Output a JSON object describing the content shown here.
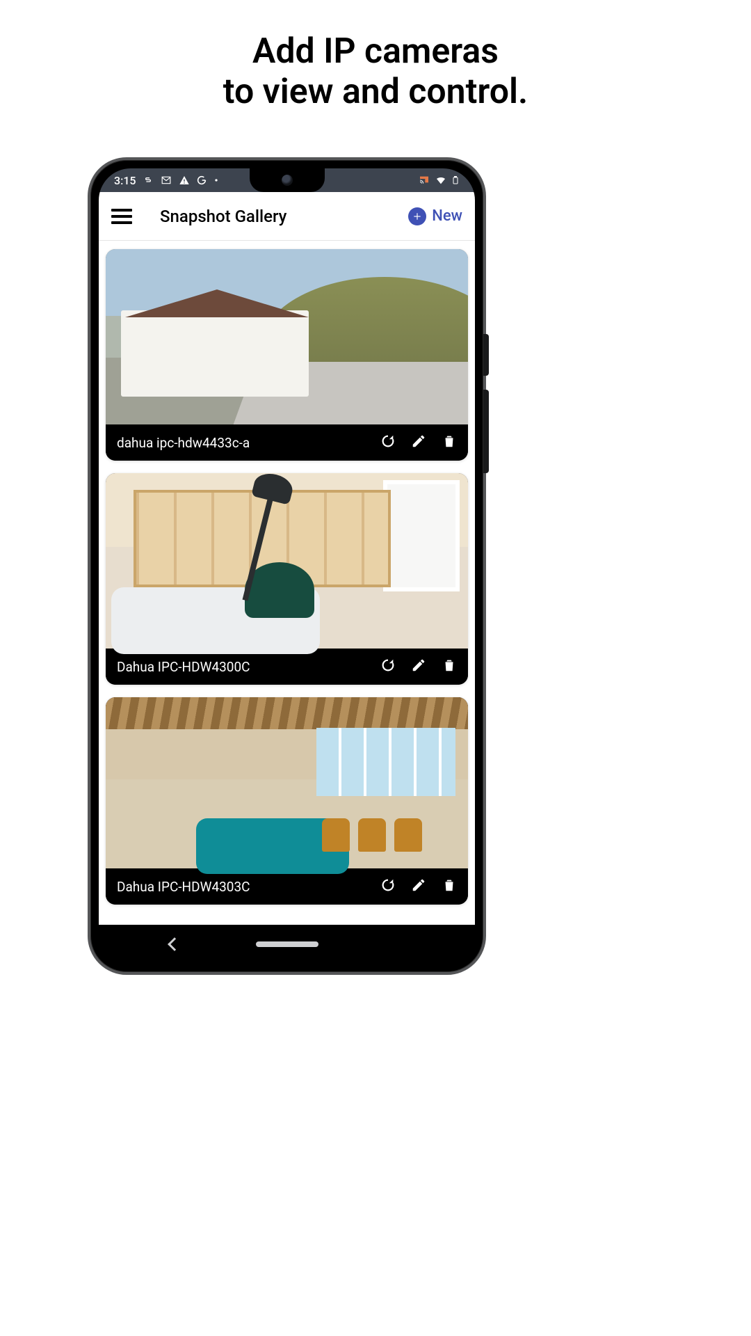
{
  "promo": {
    "line1": "Add IP cameras",
    "line2": "to view and control."
  },
  "status_bar": {
    "time": "3:15"
  },
  "app_bar": {
    "title": "Snapshot Gallery",
    "new_label": "New"
  },
  "cameras": [
    {
      "label": "dahua ipc-hdw4433c-a"
    },
    {
      "label": "Dahua IPC-HDW4300C"
    },
    {
      "label": "Dahua IPC-HDW4303C"
    }
  ],
  "colors": {
    "accent": "#3f51b5"
  }
}
